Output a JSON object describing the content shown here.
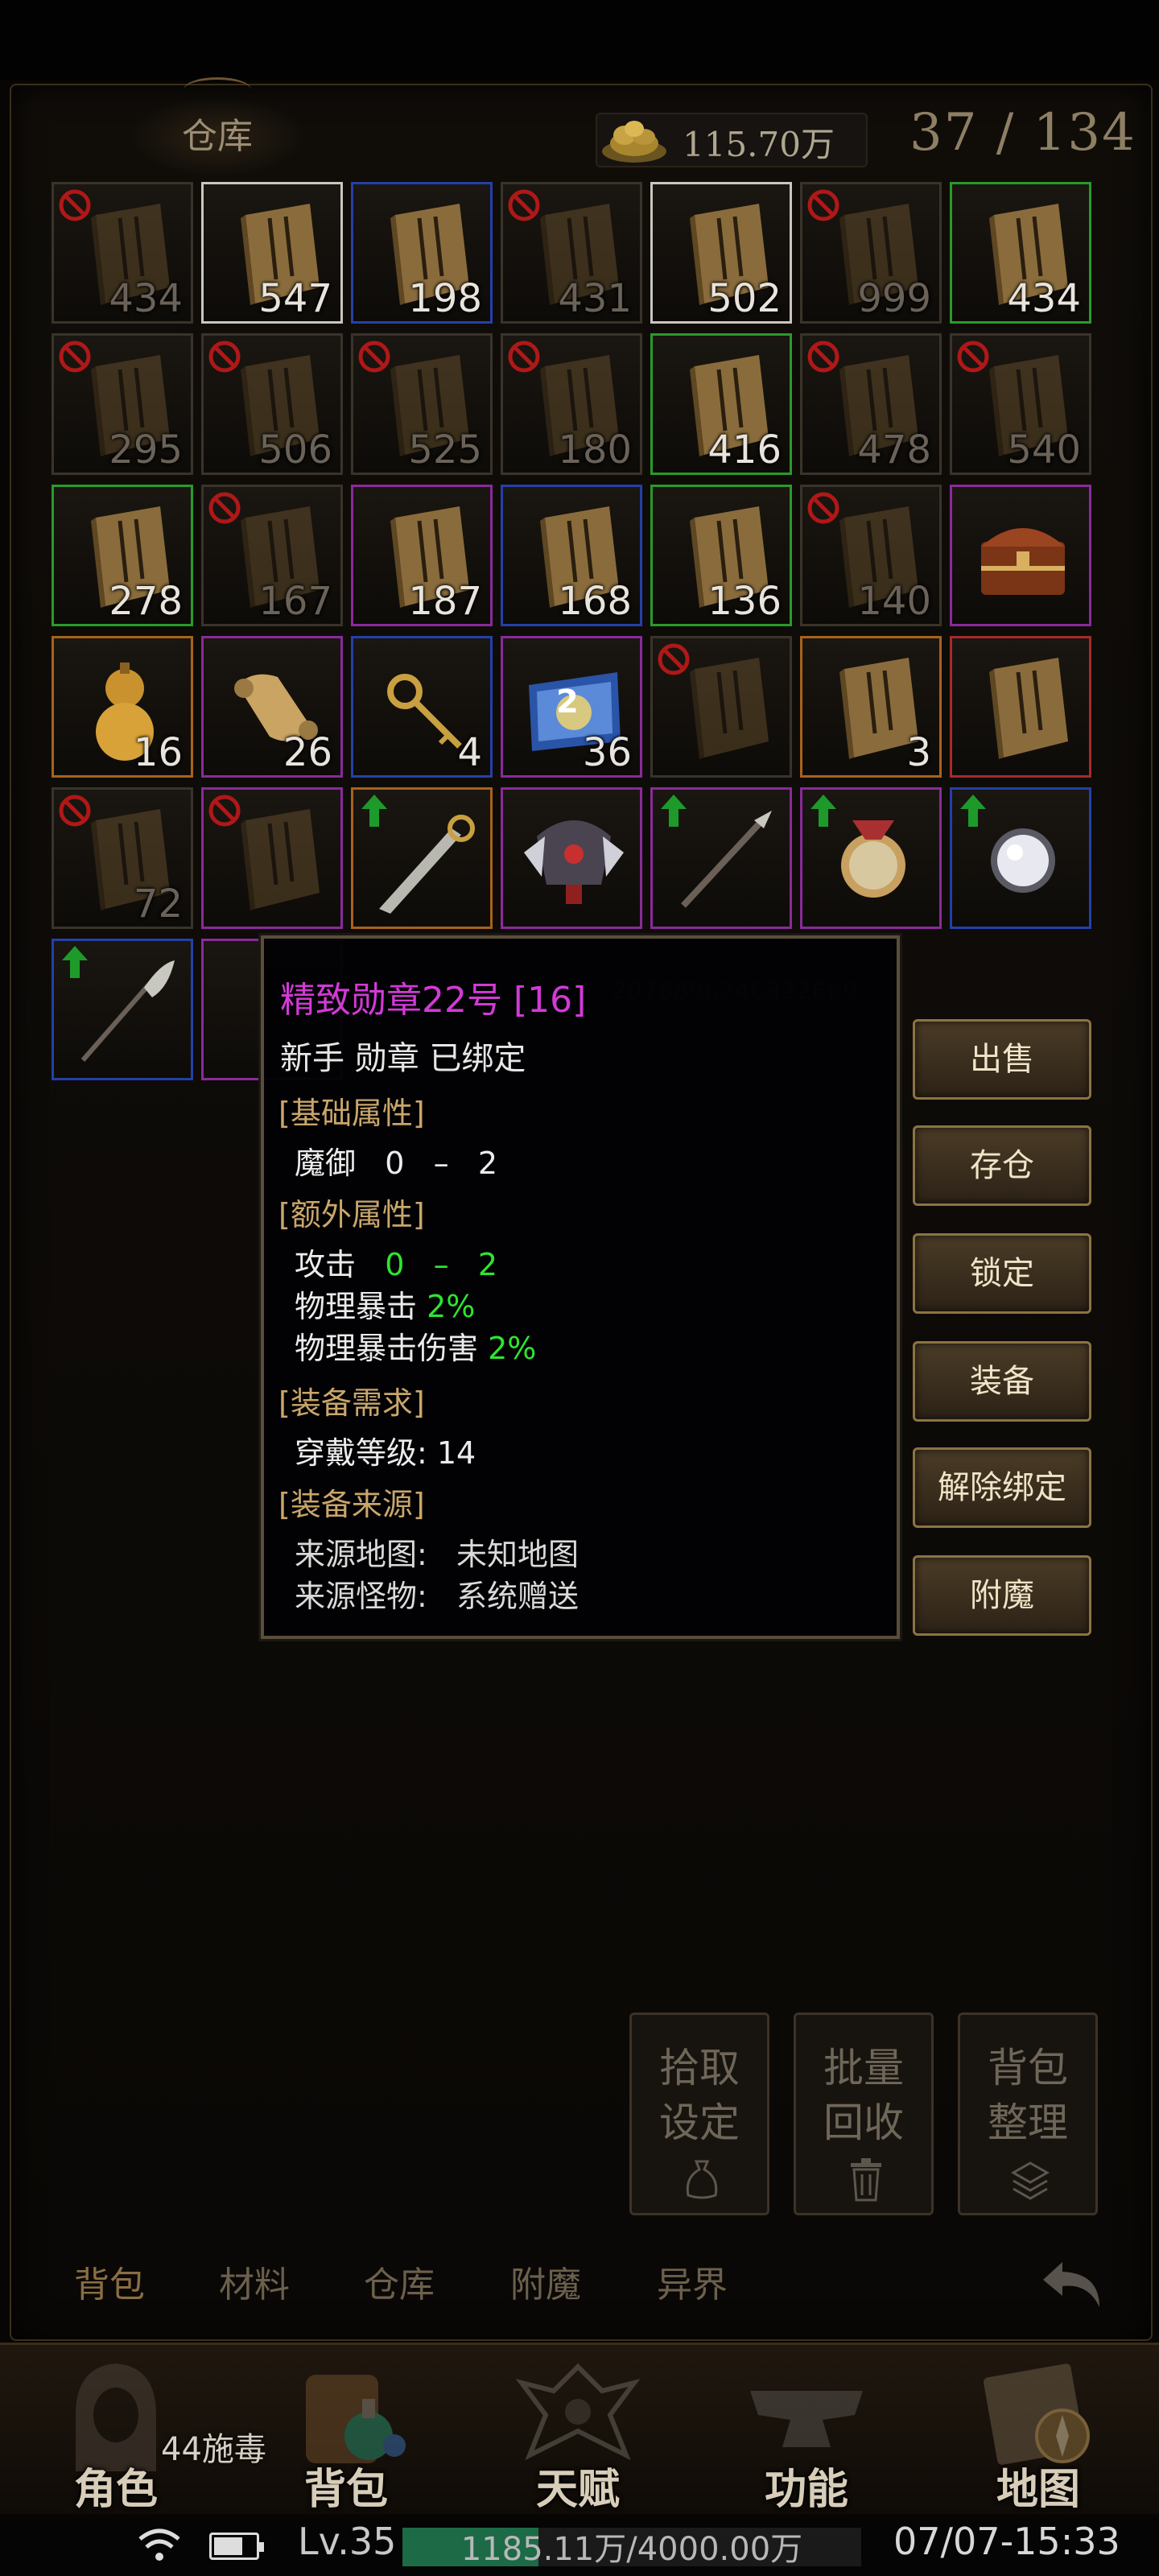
{
  "header": {
    "title": "仓库",
    "gold": "115.70万",
    "capacity": "37 / 134"
  },
  "inventory": [
    {
      "count": "434",
      "quality": "gray",
      "banned": true,
      "dim": true,
      "kind": "book",
      "text": "",
      "up": false
    },
    {
      "count": "547",
      "quality": "white",
      "banned": false,
      "dim": false,
      "kind": "book",
      "text": "",
      "up": false
    },
    {
      "count": "198",
      "quality": "blue",
      "banned": false,
      "dim": false,
      "kind": "book",
      "text": "",
      "up": false
    },
    {
      "count": "431",
      "quality": "gray",
      "banned": true,
      "dim": true,
      "kind": "book",
      "text": "",
      "up": false
    },
    {
      "count": "502",
      "quality": "white",
      "banned": false,
      "dim": false,
      "kind": "book",
      "text": "",
      "up": false
    },
    {
      "count": "999",
      "quality": "gray",
      "banned": true,
      "dim": true,
      "kind": "book",
      "text": "",
      "up": false
    },
    {
      "count": "434",
      "quality": "green",
      "banned": false,
      "dim": false,
      "kind": "book",
      "text": "",
      "up": false
    },
    {
      "count": "295",
      "quality": "gray",
      "banned": true,
      "dim": true,
      "kind": "book",
      "text": "",
      "up": false
    },
    {
      "count": "506",
      "quality": "gray",
      "banned": true,
      "dim": true,
      "kind": "book",
      "text": "",
      "up": false
    },
    {
      "count": "525",
      "quality": "gray",
      "banned": true,
      "dim": true,
      "kind": "book",
      "text": "",
      "up": false
    },
    {
      "count": "180",
      "quality": "gray",
      "banned": true,
      "dim": true,
      "kind": "book",
      "text": "",
      "up": false
    },
    {
      "count": "416",
      "quality": "green",
      "banned": false,
      "dim": false,
      "kind": "book",
      "text": "",
      "up": false
    },
    {
      "count": "478",
      "quality": "gray",
      "banned": true,
      "dim": true,
      "kind": "book",
      "text": "",
      "up": false
    },
    {
      "count": "540",
      "quality": "gray",
      "banned": true,
      "dim": true,
      "kind": "book",
      "text": "",
      "up": false
    },
    {
      "count": "278",
      "quality": "green",
      "banned": false,
      "dim": false,
      "kind": "book",
      "text": "",
      "up": false
    },
    {
      "count": "167",
      "quality": "gray",
      "banned": true,
      "dim": true,
      "kind": "book",
      "text": "",
      "up": false
    },
    {
      "count": "187",
      "quality": "purple",
      "banned": false,
      "dim": false,
      "kind": "book",
      "text": "",
      "up": false
    },
    {
      "count": "168",
      "quality": "blue",
      "banned": false,
      "dim": false,
      "kind": "book",
      "text": "",
      "up": false
    },
    {
      "count": "136",
      "quality": "green",
      "banned": false,
      "dim": false,
      "kind": "book",
      "text": "",
      "up": false
    },
    {
      "count": "140",
      "quality": "gray",
      "banned": true,
      "dim": true,
      "kind": "book",
      "text": "",
      "up": false
    },
    {
      "count": "",
      "quality": "purple",
      "banned": false,
      "dim": false,
      "kind": "chest",
      "text": "",
      "up": false
    },
    {
      "count": "16",
      "quality": "orange",
      "banned": false,
      "dim": false,
      "kind": "gourd",
      "text": "",
      "up": false
    },
    {
      "count": "26",
      "quality": "purple",
      "banned": false,
      "dim": false,
      "kind": "scroll",
      "text": "",
      "up": false
    },
    {
      "count": "4",
      "quality": "blue",
      "banned": false,
      "dim": false,
      "kind": "key",
      "text": "",
      "up": false
    },
    {
      "count": "36",
      "quality": "purple",
      "banned": false,
      "dim": false,
      "kind": "map",
      "text": "2",
      "up": false
    },
    {
      "count": "",
      "quality": "gray",
      "banned": true,
      "dim": true,
      "kind": "book",
      "text": "",
      "up": false
    },
    {
      "count": "3",
      "quality": "orange",
      "banned": false,
      "dim": false,
      "kind": "book",
      "text": "",
      "up": false
    },
    {
      "count": "",
      "quality": "red",
      "banned": false,
      "dim": false,
      "kind": "book",
      "text": "",
      "up": false
    },
    {
      "count": "72",
      "quality": "gray",
      "banned": true,
      "dim": true,
      "kind": "book",
      "text": "",
      "up": false
    },
    {
      "count": "",
      "quality": "purple",
      "banned": true,
      "dim": true,
      "kind": "book",
      "text": "",
      "up": false
    },
    {
      "count": "",
      "quality": "orange",
      "banned": false,
      "dim": false,
      "kind": "blade",
      "text": "",
      "up": true
    },
    {
      "count": "",
      "quality": "purple",
      "banned": false,
      "dim": false,
      "kind": "helm",
      "text": "",
      "up": false
    },
    {
      "count": "",
      "quality": "purple",
      "banned": false,
      "dim": false,
      "kind": "spear",
      "text": "",
      "up": true
    },
    {
      "count": "",
      "quality": "purple",
      "banned": false,
      "dim": false,
      "kind": "medal",
      "text": "",
      "up": true
    },
    {
      "count": "",
      "quality": "blue",
      "banned": false,
      "dim": false,
      "kind": "orb",
      "text": "",
      "up": true
    },
    {
      "count": "",
      "quality": "blue",
      "banned": false,
      "dim": false,
      "kind": "glaive",
      "text": "",
      "up": true
    },
    {
      "count": "",
      "quality": "purple",
      "banned": false,
      "dim": false,
      "kind": "empty",
      "text": "",
      "up": false
    }
  ],
  "tooltip": {
    "title": "精致勋章22号 [16]",
    "subtitle": "新手 勋章 已绑定",
    "hidden_id": "20788962468226b9",
    "section_basic": "[基础属性]",
    "basic_line": "魔御   0   –   2",
    "section_extra": "[额外属性]",
    "attack_label": "攻击",
    "attack_value": "0   –   2",
    "crit_label": "物理暴击",
    "crit_value": "2%",
    "critdmg_label": "物理暴击伤害",
    "critdmg_value": "2%",
    "section_req": "[装备需求]",
    "req_line": "穿戴等级: 14",
    "section_source": "[装备来源]",
    "source_map": "来源地图:   未知地图",
    "source_monster": "来源怪物:   系统赠送"
  },
  "actions": [
    "出售",
    "存仓",
    "锁定",
    "装备",
    "解除绑定",
    "附魔"
  ],
  "bottom_buttons": [
    {
      "line1": "拾取",
      "line2": "设定",
      "icon": "pouch-icon"
    },
    {
      "line1": "批量",
      "line2": "回收",
      "icon": "trash-icon"
    },
    {
      "line1": "背包",
      "line2": "整理",
      "icon": "layers-icon"
    }
  ],
  "tabs": [
    "背包",
    "材料",
    "仓库",
    "附魔",
    "异界"
  ],
  "nav": [
    "角色",
    "背包",
    "天赋",
    "功能",
    "地图"
  ],
  "skill_tag": "44施毒",
  "status": {
    "level": "Lv.35",
    "exp_text": "1185.11万/4000.00万",
    "exp_fraction": 0.296,
    "time": "07/07-15:33",
    "battery_fraction": 0.7
  }
}
